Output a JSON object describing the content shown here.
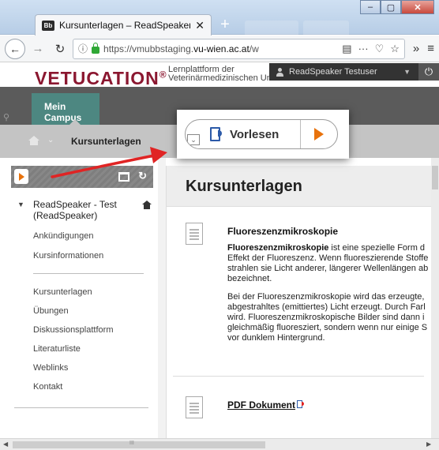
{
  "browser": {
    "tab_favicon": "Bb",
    "tab_title": "Kursunterlagen – ReadSpeaker",
    "tab_close": "✕",
    "new_tab": "+",
    "url_prefix": "https://vmubbstaging.",
    "url_domain": "vu-wien.ac.at",
    "url_suffix": "/w",
    "window_buttons": {
      "minimize": "–",
      "maximize": "▢",
      "close": "✕"
    },
    "icons": [
      "back-icon",
      "forward-icon",
      "reload-icon",
      "info-icon",
      "lock-icon",
      "reader-icon",
      "more-icon",
      "pocket-icon",
      "bookmark-icon",
      "overflow-icon",
      "menu-icon"
    ]
  },
  "header": {
    "logo": "VETUCATION",
    "logo_mark": "®",
    "tagline_line1": "Lernplattform der",
    "tagline_line2": "Veterinärmedizinischen Universität Wien",
    "user_name": "ReadSpeaker Testuser",
    "user_caret": "▼",
    "logout_icon": "⏻"
  },
  "campus": {
    "tab_label": "Mein Campus"
  },
  "breadcrumb": {
    "caret": "⌄",
    "current": "Kursunterlagen"
  },
  "readspeaker": {
    "expand_symbol": "⌄",
    "read_label": "Vorlesen"
  },
  "sidebar": {
    "refresh_icon": "↻",
    "course_caret": "▼",
    "course_title_line1": "ReadSpeaker - Test",
    "course_title_line2": "(ReadSpeaker)",
    "group1": [
      "Ankündigungen",
      "Kursinformationen"
    ],
    "group2": [
      "Kursunterlagen",
      "Übungen",
      "Diskussionsplattform",
      "Literaturliste",
      "Weblinks",
      "Kontakt"
    ]
  },
  "main": {
    "title": "Kursunterlagen",
    "item1": {
      "title": "Fluoreszenzmikroskopie",
      "p1_bold": "Fluoreszenzmikroskopie",
      "p1_rest_line1": " ist eine spezielle Form d",
      "p1_line2": "Effekt der Fluoreszenz. Wenn fluoreszierende Stoffe",
      "p1_line3": "strahlen sie Licht anderer, längerer Wellenlängen ab",
      "p1_line4": "bezeichnet.",
      "p2_line1": "Bei der Fluoreszenzmikroskopie wird das erzeugte,",
      "p2_line2": "abgestrahltes (emittiertes) Licht erzeugt. Durch Farl",
      "p2_line3": "wird. Fluoreszenzmikroskopische Bilder sind dann i",
      "p2_line4": "gleichmäßig fluoresziert, sondern wenn nur einige S",
      "p2_line5": "vor dunklem Hintergrund."
    },
    "item2": {
      "title": "PDF Dokument"
    }
  },
  "scrollbar": {
    "left_arrow": "◀",
    "right_arrow": "▶",
    "grip": "III"
  }
}
